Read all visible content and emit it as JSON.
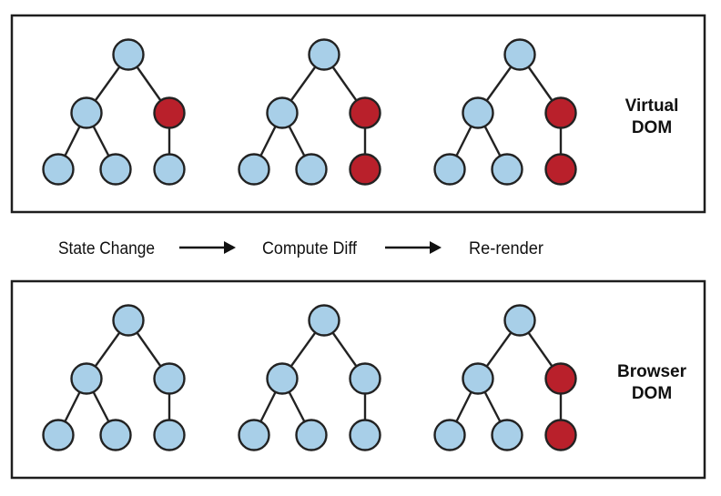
{
  "colors": {
    "unchanged": "#a8cfe8",
    "changed": "#b9202b",
    "stroke": "#222222"
  },
  "panels": [
    {
      "id": "virtual-dom",
      "label_lines": [
        "Virtual",
        "DOM"
      ],
      "trees": [
        {
          "stage": "State Change",
          "changed_nodes": [
            "right-child"
          ]
        },
        {
          "stage": "Compute Diff",
          "changed_nodes": [
            "right-child",
            "right-leaf"
          ]
        },
        {
          "stage": "Re-render",
          "changed_nodes": [
            "right-child",
            "right-leaf"
          ]
        }
      ]
    },
    {
      "id": "browser-dom",
      "label_lines": [
        "Browser",
        "DOM"
      ],
      "trees": [
        {
          "stage": "State Change",
          "changed_nodes": []
        },
        {
          "stage": "Compute Diff",
          "changed_nodes": []
        },
        {
          "stage": "Re-render",
          "changed_nodes": [
            "right-child",
            "right-leaf"
          ]
        }
      ]
    }
  ],
  "flow": {
    "steps": [
      "State Change",
      "Compute Diff",
      "Re-render"
    ]
  },
  "tree_structure": {
    "nodes": [
      "root",
      "left-child",
      "right-child",
      "left-left-leaf",
      "left-right-leaf",
      "right-leaf"
    ],
    "edges": [
      [
        "root",
        "left-child"
      ],
      [
        "root",
        "right-child"
      ],
      [
        "left-child",
        "left-left-leaf"
      ],
      [
        "left-child",
        "left-right-leaf"
      ],
      [
        "right-child",
        "right-leaf"
      ]
    ]
  }
}
